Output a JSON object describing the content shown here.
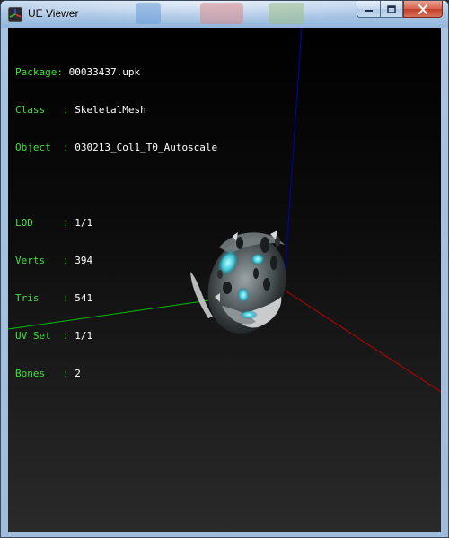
{
  "window": {
    "title": "UE Viewer"
  },
  "info": {
    "package": {
      "label": "Package: ",
      "value": "00033437.upk"
    },
    "class": {
      "label": "Class   : ",
      "value": "SkeletalMesh"
    },
    "object": {
      "label": "Object  : ",
      "value": "030213_Col1_T0_Autoscale"
    },
    "lod": {
      "label": "LOD     : ",
      "value": "1/1"
    },
    "verts": {
      "label": "Verts   : ",
      "value": "394"
    },
    "tris": {
      "label": "Tris    : ",
      "value": "541"
    },
    "uvset": {
      "label": "UV Set  : ",
      "value": "1/1"
    },
    "bones": {
      "label": "Bones   : ",
      "value": "2"
    }
  },
  "colors": {
    "label": "#40e040",
    "value": "#ffffff",
    "axis_x": "#c00000",
    "axis_y": "#0000c0",
    "axis_z": "#00c000"
  },
  "icons": {
    "app": "ue-viewer-app-icon",
    "minimize": "minimize-icon",
    "maximize": "maximize-icon",
    "close": "close-icon"
  }
}
